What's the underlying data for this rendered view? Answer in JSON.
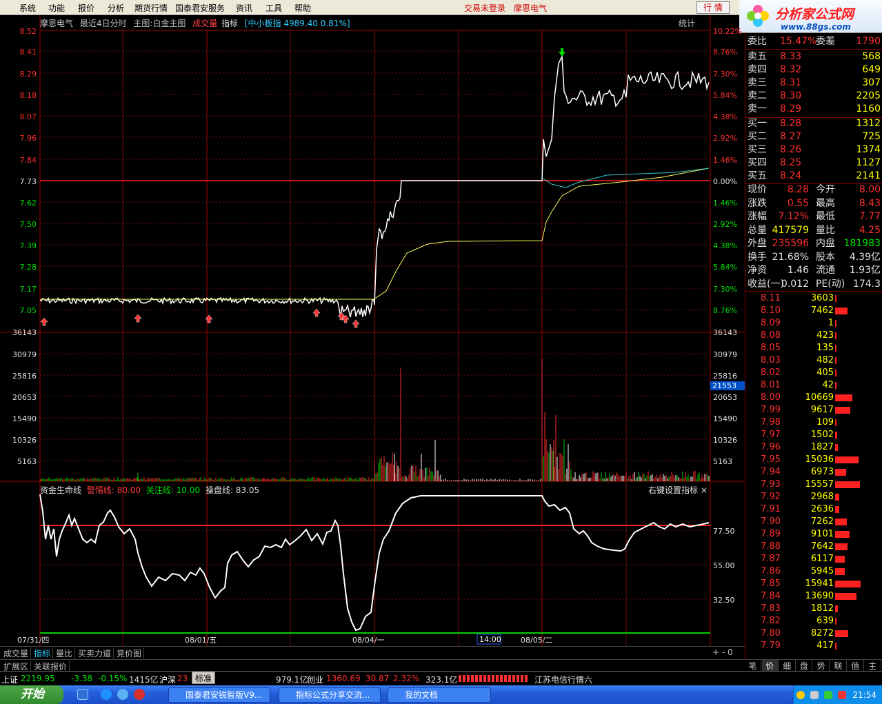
{
  "menu": {
    "items": [
      "系统",
      "功能",
      "报价",
      "分析",
      "期货行情",
      "国泰君安服务",
      "资讯",
      "工具",
      "帮助"
    ],
    "login_status": "交易未登录",
    "stock_name_top": "摩恩电气",
    "quote_button": "行 情"
  },
  "logo": {
    "title": "分析家公式网",
    "url": "www.88gs.com"
  },
  "chart_header": {
    "stock": "摩恩电气",
    "period": "最近4日分时",
    "main_chart": "主图:白金主图",
    "volume_label": "成交量",
    "indicator": "指标",
    "index_info": "[中小板指 4989.40 0.81%]",
    "stat": "统计"
  },
  "indicator_header": {
    "name": "资金生命线",
    "warn": "警惕线: 80.00",
    "focus": "关注线: 10.00",
    "operate": "操盘线: 83.05",
    "right_menu": "右键设置指标"
  },
  "axes": {
    "price_left": [
      "8.52",
      "8.41",
      "8.29",
      "8.18",
      "8.07",
      "7.96",
      "7.84",
      "7.73",
      "7.62",
      "7.50",
      "7.39",
      "7.28",
      "7.17",
      "7.05"
    ],
    "pct_right": [
      "10.22%",
      "8.76%",
      "7.30%",
      "5.84%",
      "4.38%",
      "2.92%",
      "1.46%",
      "0.00%",
      "1.46%",
      "2.92%",
      "4.38%",
      "5.84%",
      "7.30%",
      "8.76%"
    ],
    "volume_left": [
      "36143",
      "30979",
      "25816",
      "20653",
      "15490",
      "10326",
      "5163"
    ],
    "volume_right": [
      "36143",
      "30979",
      "25816",
      "20653",
      "15490",
      "10326",
      "5163"
    ],
    "volume_marker": "21553",
    "ind_right": [
      "77.50",
      "55.00",
      "32.50"
    ],
    "dates": [
      "07/31/四",
      "08/01/五",
      "08/04/一",
      "08/05/二"
    ],
    "cursor_time": "14:00"
  },
  "quote": {
    "weibi_label": "委比",
    "weibi": "15.47%",
    "weicha_label": "委差",
    "weicha": "1790",
    "asks": [
      {
        "label": "卖五",
        "price": "8.33",
        "vol": "568"
      },
      {
        "label": "卖四",
        "price": "8.32",
        "vol": "649"
      },
      {
        "label": "卖三",
        "price": "8.31",
        "vol": "307"
      },
      {
        "label": "卖二",
        "price": "8.30",
        "vol": "2205"
      },
      {
        "label": "卖一",
        "price": "8.29",
        "vol": "1160"
      }
    ],
    "bids": [
      {
        "label": "买一",
        "price": "8.28",
        "vol": "1312"
      },
      {
        "label": "买二",
        "price": "8.27",
        "vol": "725"
      },
      {
        "label": "买三",
        "price": "8.26",
        "vol": "1374"
      },
      {
        "label": "买四",
        "price": "8.25",
        "vol": "1127"
      },
      {
        "label": "买五",
        "price": "8.24",
        "vol": "2141"
      }
    ],
    "stats": [
      {
        "l1": "现价",
        "v1": "8.28",
        "l2": "今开",
        "v2": "8.00",
        "c1": "red",
        "c2": "red"
      },
      {
        "l1": "涨跌",
        "v1": "0.55",
        "l2": "最高",
        "v2": "8.43",
        "c1": "red",
        "c2": "red"
      },
      {
        "l1": "涨幅",
        "v1": "7.12%",
        "l2": "最低",
        "v2": "7.77",
        "c1": "red",
        "c2": "red"
      },
      {
        "l1": "总量",
        "v1": "417579",
        "l2": "量比",
        "v2": "4.25",
        "c1": "yel",
        "c2": "red"
      },
      {
        "l1": "外盘",
        "v1": "235596",
        "l2": "内盘",
        "v2": "181983",
        "c1": "red",
        "c2": "grn"
      },
      {
        "l1": "换手",
        "v1": "21.68%",
        "l2": "股本",
        "v2": "4.39亿",
        "c1": "wht",
        "c2": "wht"
      },
      {
        "l1": "净资",
        "v1": "1.46",
        "l2": "流通",
        "v2": "1.93亿",
        "c1": "wht",
        "c2": "wht"
      },
      {
        "l1": "收益(一)",
        "v1": "0.012",
        "l2": "PE(动)",
        "v2": "174.3",
        "c1": "wht",
        "c2": "wht"
      }
    ]
  },
  "depth": [
    {
      "price": "8.11",
      "vol": "3603",
      "pct": 0.03
    },
    {
      "price": "8.10",
      "vol": "7462",
      "pct": 0.23
    },
    {
      "price": "8.09",
      "vol": "1",
      "pct": 0.01
    },
    {
      "price": "8.08",
      "vol": "423",
      "pct": 0.01
    },
    {
      "price": "8.05",
      "vol": "135",
      "pct": 0.01
    },
    {
      "price": "8.03",
      "vol": "482",
      "pct": 0.01
    },
    {
      "price": "8.02",
      "vol": "405",
      "pct": 0.01
    },
    {
      "price": "8.01",
      "vol": "42",
      "pct": 0.01
    },
    {
      "price": "8.00",
      "vol": "10669",
      "pct": 0.31
    },
    {
      "price": "7.99",
      "vol": "9617",
      "pct": 0.27
    },
    {
      "price": "7.98",
      "vol": "109",
      "pct": 0.01
    },
    {
      "price": "7.97",
      "vol": "1502",
      "pct": 0.04
    },
    {
      "price": "7.96",
      "vol": "1827",
      "pct": 0.05
    },
    {
      "price": "7.95",
      "vol": "15036",
      "pct": 0.43
    },
    {
      "price": "7.94",
      "vol": "6973",
      "pct": 0.2
    },
    {
      "price": "7.93",
      "vol": "15557",
      "pct": 0.45
    },
    {
      "price": "7.92",
      "vol": "2968",
      "pct": 0.08
    },
    {
      "price": "7.91",
      "vol": "2636",
      "pct": 0.07
    },
    {
      "price": "7.90",
      "vol": "7262",
      "pct": 0.21
    },
    {
      "price": "7.89",
      "vol": "9101",
      "pct": 0.26
    },
    {
      "price": "7.88",
      "vol": "7642",
      "pct": 0.22
    },
    {
      "price": "7.87",
      "vol": "6117",
      "pct": 0.18
    },
    {
      "price": "7.86",
      "vol": "5945",
      "pct": 0.17
    },
    {
      "price": "7.85",
      "vol": "15941",
      "pct": 0.46
    },
    {
      "price": "7.84",
      "vol": "13690",
      "pct": 0.39
    },
    {
      "price": "7.83",
      "vol": "1812",
      "pct": 0.05
    },
    {
      "price": "7.82",
      "vol": "639",
      "pct": 0.02
    },
    {
      "price": "7.80",
      "vol": "8272",
      "pct": 0.24
    },
    {
      "price": "7.79",
      "vol": "417",
      "pct": 0.01
    }
  ],
  "bottom_tabs": [
    "成交量",
    "指标",
    "量比",
    "买卖力道",
    "竞价图"
  ],
  "bottom_tabs2": [
    "扩展区",
    "关联报价"
  ],
  "rp_tabs": [
    "笔",
    "价",
    "细",
    "盘",
    "势",
    "联",
    "值",
    "主"
  ],
  "status": {
    "sh_label": "上证",
    "sh_val": "2219.95",
    "sh_chg": "-3.38",
    "sh_pct": "-0.15%",
    "sh_amt": "1415亿",
    "hs_label": "沪深",
    "hs_val": "23",
    "std": "标准",
    "cy_amt0": "979.1亿",
    "cy_label": "创业",
    "cy_val": "1360.69",
    "cy_chg": "30.87",
    "cy_pct": "2.32%",
    "cy_amt": "323.1亿",
    "news": "江苏电信行情六"
  },
  "taskbar": {
    "start": "开始",
    "tasks": [
      "国泰君安锐智版V9...",
      "指标公式分享交流...",
      "我的文档"
    ],
    "clock": "21:54"
  }
}
